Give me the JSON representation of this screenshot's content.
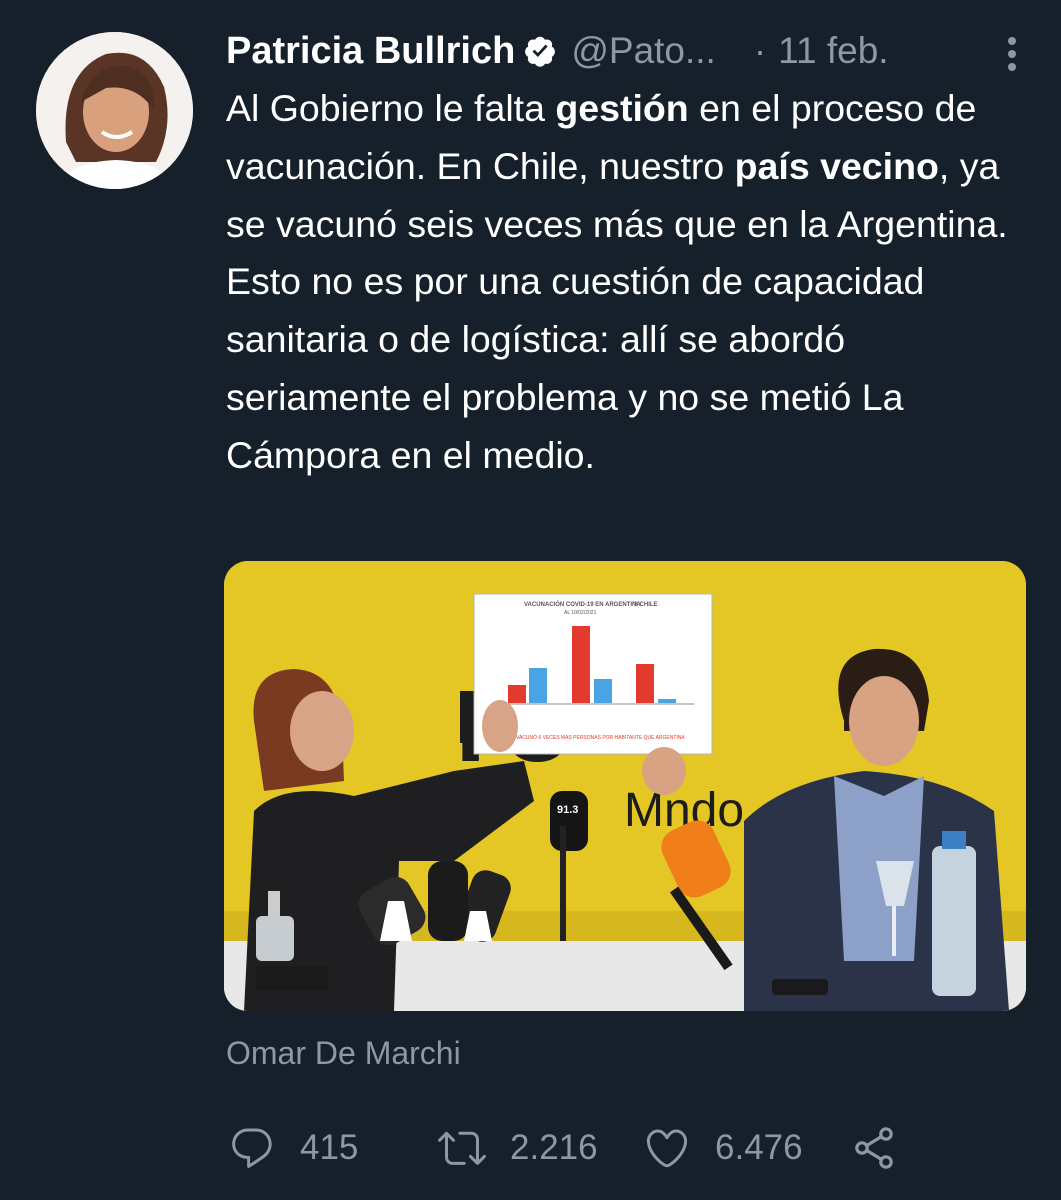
{
  "author": {
    "name": "Patricia Bullrich",
    "handle": "@Pato...",
    "separator": "·",
    "date": "11 feb."
  },
  "tweet": {
    "parts": [
      "Al Gobierno le falta ",
      "gestión",
      " en el proceso de vacunación. En Chile, nuestro ",
      "país vecino",
      ", ya se vacunó seis veces más que en la Argentina. Esto no es por una cuestión de capacidad sanitaria o de logística: allí se abordó seriamente el problema y no se metió La Cámpora en el medio."
    ]
  },
  "media": {
    "sign": {
      "title": "VACUNACIÓN COVID-19 EN ARGENTINA",
      "title_suffix": "Y CHILE",
      "subtitle": "AL 10/02/2021",
      "footer": "VACUNÓ 6 VECES MÁS PERSONAS POR HABITANTE QUE ARGENTINA"
    },
    "mic_label": "91.3",
    "colors": {
      "background": "#e4c624",
      "bar_red": "#e23b2e",
      "bar_blue": "#4aa3e3"
    }
  },
  "image_tag": "Omar De Marchi",
  "actions": {
    "reply_count": "415",
    "retweet_count": "2.216",
    "like_count": "6.476"
  },
  "icons": [
    "verified-icon",
    "more-icon",
    "reply-icon",
    "retweet-icon",
    "like-icon",
    "share-icon"
  ],
  "colors": {
    "background": "#15202b",
    "secondary_text": "#8b98a5",
    "verified": "#ffffff"
  }
}
